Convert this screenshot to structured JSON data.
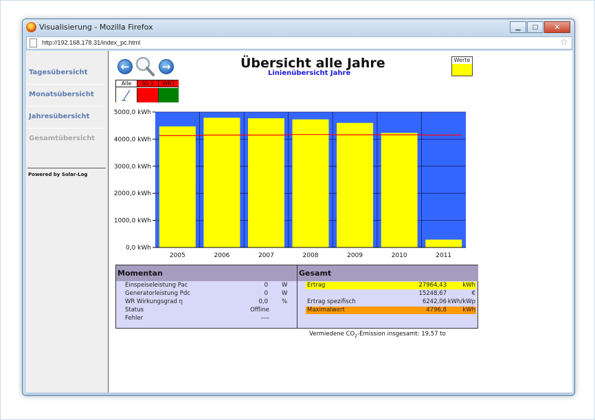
{
  "window": {
    "title": "Visualisierung - Mozilla Firefox",
    "url": "http://192.168.178.31/index_pc.html"
  },
  "sidebar": {
    "items": [
      {
        "label": "Tagesübersicht"
      },
      {
        "label": "Monatsübersicht"
      },
      {
        "label": "Jahresübersicht"
      },
      {
        "label": "Gesamtübersicht"
      }
    ],
    "powered_by": "Powered by Solar-Log"
  },
  "header": {
    "title": "Übersicht alle Jahre",
    "subtitle": "Linienübersicht Jahre"
  },
  "legend": {
    "werte_label": "Werte",
    "werte_color": "#ffff00"
  },
  "selector": {
    "all_label": "Alle",
    "s0_label": "S0 1",
    "wr_label": "WR1"
  },
  "chart_data": {
    "type": "bar",
    "categories": [
      "2005",
      "2006",
      "2007",
      "2008",
      "2009",
      "2010",
      "2011"
    ],
    "values": [
      4470,
      4790,
      4770,
      4730,
      4600,
      4230,
      290
    ],
    "reference_line": [
      4130,
      4150,
      4150,
      4170,
      4160,
      4160,
      4150
    ],
    "y_ticks": [
      "0,0 kWh",
      "1000,0 kWh",
      "2000,0 kWh",
      "3000,0 kWh",
      "4000,0 kWh",
      "5000,0 kWh"
    ],
    "ylim": [
      0,
      5000
    ],
    "colors": {
      "bar": "#ffff00",
      "background": "#3366ff",
      "line": "#ff0000",
      "grid": "#1a1a66"
    }
  },
  "momentan": {
    "title": "Momentan",
    "rows": [
      {
        "label": "Einspeiseleistung Pac",
        "value": "0",
        "unit": "W"
      },
      {
        "label": "Generatorleistung Pdc",
        "value": "0",
        "unit": "W"
      },
      {
        "label": "WR Wirkungsgrad η",
        "value": "0,0",
        "unit": "%"
      },
      {
        "label": "Status",
        "value": "Offline",
        "unit": ""
      },
      {
        "label": "Fehler",
        "value": "----",
        "unit": ""
      }
    ]
  },
  "gesamt": {
    "title": "Gesamt",
    "rows": [
      {
        "label": "Ertrag",
        "value": "27964,43",
        "unit": "kWh",
        "highlight": "#ffff00"
      },
      {
        "label": "",
        "value": "15248,67",
        "unit": "€",
        "highlight": ""
      },
      {
        "label": "Ertrag spezifisch",
        "value": "6242,06",
        "unit": "kWh/kWp",
        "highlight": ""
      },
      {
        "label": "Maximalwert",
        "value": "4796,8",
        "unit": "kWh",
        "highlight": "#ff9900"
      }
    ]
  },
  "emission": {
    "prefix": "Vermiedene CO",
    "sub": "2",
    "suffix": "-Emission insgesamt: 19,57 to"
  }
}
